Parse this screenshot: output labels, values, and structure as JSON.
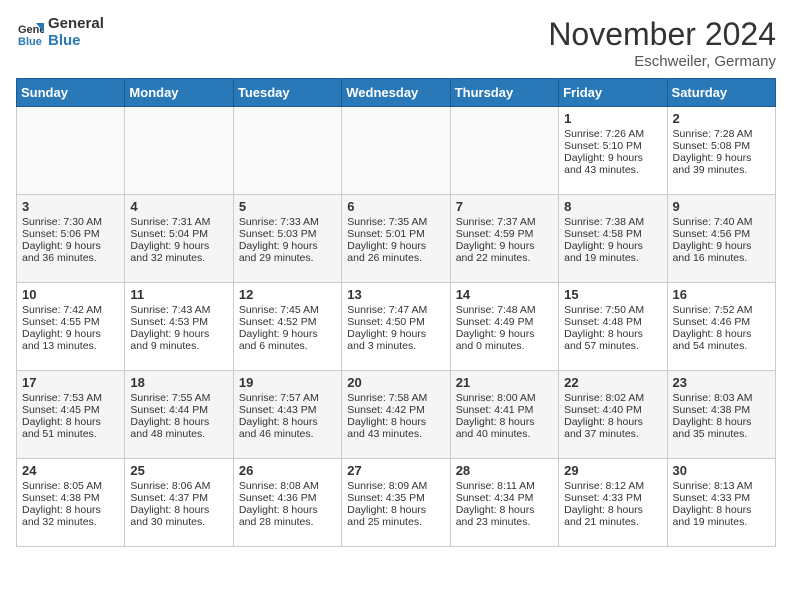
{
  "header": {
    "logo_line1": "General",
    "logo_line2": "Blue",
    "month": "November 2024",
    "location": "Eschweiler, Germany"
  },
  "days_of_week": [
    "Sunday",
    "Monday",
    "Tuesday",
    "Wednesday",
    "Thursday",
    "Friday",
    "Saturday"
  ],
  "weeks": [
    [
      {
        "day": "",
        "info": ""
      },
      {
        "day": "",
        "info": ""
      },
      {
        "day": "",
        "info": ""
      },
      {
        "day": "",
        "info": ""
      },
      {
        "day": "",
        "info": ""
      },
      {
        "day": "1",
        "sunrise": "Sunrise: 7:26 AM",
        "sunset": "Sunset: 5:10 PM",
        "daylight": "Daylight: 9 hours and 43 minutes."
      },
      {
        "day": "2",
        "sunrise": "Sunrise: 7:28 AM",
        "sunset": "Sunset: 5:08 PM",
        "daylight": "Daylight: 9 hours and 39 minutes."
      }
    ],
    [
      {
        "day": "3",
        "sunrise": "Sunrise: 7:30 AM",
        "sunset": "Sunset: 5:06 PM",
        "daylight": "Daylight: 9 hours and 36 minutes."
      },
      {
        "day": "4",
        "sunrise": "Sunrise: 7:31 AM",
        "sunset": "Sunset: 5:04 PM",
        "daylight": "Daylight: 9 hours and 32 minutes."
      },
      {
        "day": "5",
        "sunrise": "Sunrise: 7:33 AM",
        "sunset": "Sunset: 5:03 PM",
        "daylight": "Daylight: 9 hours and 29 minutes."
      },
      {
        "day": "6",
        "sunrise": "Sunrise: 7:35 AM",
        "sunset": "Sunset: 5:01 PM",
        "daylight": "Daylight: 9 hours and 26 minutes."
      },
      {
        "day": "7",
        "sunrise": "Sunrise: 7:37 AM",
        "sunset": "Sunset: 4:59 PM",
        "daylight": "Daylight: 9 hours and 22 minutes."
      },
      {
        "day": "8",
        "sunrise": "Sunrise: 7:38 AM",
        "sunset": "Sunset: 4:58 PM",
        "daylight": "Daylight: 9 hours and 19 minutes."
      },
      {
        "day": "9",
        "sunrise": "Sunrise: 7:40 AM",
        "sunset": "Sunset: 4:56 PM",
        "daylight": "Daylight: 9 hours and 16 minutes."
      }
    ],
    [
      {
        "day": "10",
        "sunrise": "Sunrise: 7:42 AM",
        "sunset": "Sunset: 4:55 PM",
        "daylight": "Daylight: 9 hours and 13 minutes."
      },
      {
        "day": "11",
        "sunrise": "Sunrise: 7:43 AM",
        "sunset": "Sunset: 4:53 PM",
        "daylight": "Daylight: 9 hours and 9 minutes."
      },
      {
        "day": "12",
        "sunrise": "Sunrise: 7:45 AM",
        "sunset": "Sunset: 4:52 PM",
        "daylight": "Daylight: 9 hours and 6 minutes."
      },
      {
        "day": "13",
        "sunrise": "Sunrise: 7:47 AM",
        "sunset": "Sunset: 4:50 PM",
        "daylight": "Daylight: 9 hours and 3 minutes."
      },
      {
        "day": "14",
        "sunrise": "Sunrise: 7:48 AM",
        "sunset": "Sunset: 4:49 PM",
        "daylight": "Daylight: 9 hours and 0 minutes."
      },
      {
        "day": "15",
        "sunrise": "Sunrise: 7:50 AM",
        "sunset": "Sunset: 4:48 PM",
        "daylight": "Daylight: 8 hours and 57 minutes."
      },
      {
        "day": "16",
        "sunrise": "Sunrise: 7:52 AM",
        "sunset": "Sunset: 4:46 PM",
        "daylight": "Daylight: 8 hours and 54 minutes."
      }
    ],
    [
      {
        "day": "17",
        "sunrise": "Sunrise: 7:53 AM",
        "sunset": "Sunset: 4:45 PM",
        "daylight": "Daylight: 8 hours and 51 minutes."
      },
      {
        "day": "18",
        "sunrise": "Sunrise: 7:55 AM",
        "sunset": "Sunset: 4:44 PM",
        "daylight": "Daylight: 8 hours and 48 minutes."
      },
      {
        "day": "19",
        "sunrise": "Sunrise: 7:57 AM",
        "sunset": "Sunset: 4:43 PM",
        "daylight": "Daylight: 8 hours and 46 minutes."
      },
      {
        "day": "20",
        "sunrise": "Sunrise: 7:58 AM",
        "sunset": "Sunset: 4:42 PM",
        "daylight": "Daylight: 8 hours and 43 minutes."
      },
      {
        "day": "21",
        "sunrise": "Sunrise: 8:00 AM",
        "sunset": "Sunset: 4:41 PM",
        "daylight": "Daylight: 8 hours and 40 minutes."
      },
      {
        "day": "22",
        "sunrise": "Sunrise: 8:02 AM",
        "sunset": "Sunset: 4:40 PM",
        "daylight": "Daylight: 8 hours and 37 minutes."
      },
      {
        "day": "23",
        "sunrise": "Sunrise: 8:03 AM",
        "sunset": "Sunset: 4:38 PM",
        "daylight": "Daylight: 8 hours and 35 minutes."
      }
    ],
    [
      {
        "day": "24",
        "sunrise": "Sunrise: 8:05 AM",
        "sunset": "Sunset: 4:38 PM",
        "daylight": "Daylight: 8 hours and 32 minutes."
      },
      {
        "day": "25",
        "sunrise": "Sunrise: 8:06 AM",
        "sunset": "Sunset: 4:37 PM",
        "daylight": "Daylight: 8 hours and 30 minutes."
      },
      {
        "day": "26",
        "sunrise": "Sunrise: 8:08 AM",
        "sunset": "Sunset: 4:36 PM",
        "daylight": "Daylight: 8 hours and 28 minutes."
      },
      {
        "day": "27",
        "sunrise": "Sunrise: 8:09 AM",
        "sunset": "Sunset: 4:35 PM",
        "daylight": "Daylight: 8 hours and 25 minutes."
      },
      {
        "day": "28",
        "sunrise": "Sunrise: 8:11 AM",
        "sunset": "Sunset: 4:34 PM",
        "daylight": "Daylight: 8 hours and 23 minutes."
      },
      {
        "day": "29",
        "sunrise": "Sunrise: 8:12 AM",
        "sunset": "Sunset: 4:33 PM",
        "daylight": "Daylight: 8 hours and 21 minutes."
      },
      {
        "day": "30",
        "sunrise": "Sunrise: 8:13 AM",
        "sunset": "Sunset: 4:33 PM",
        "daylight": "Daylight: 8 hours and 19 minutes."
      }
    ]
  ]
}
